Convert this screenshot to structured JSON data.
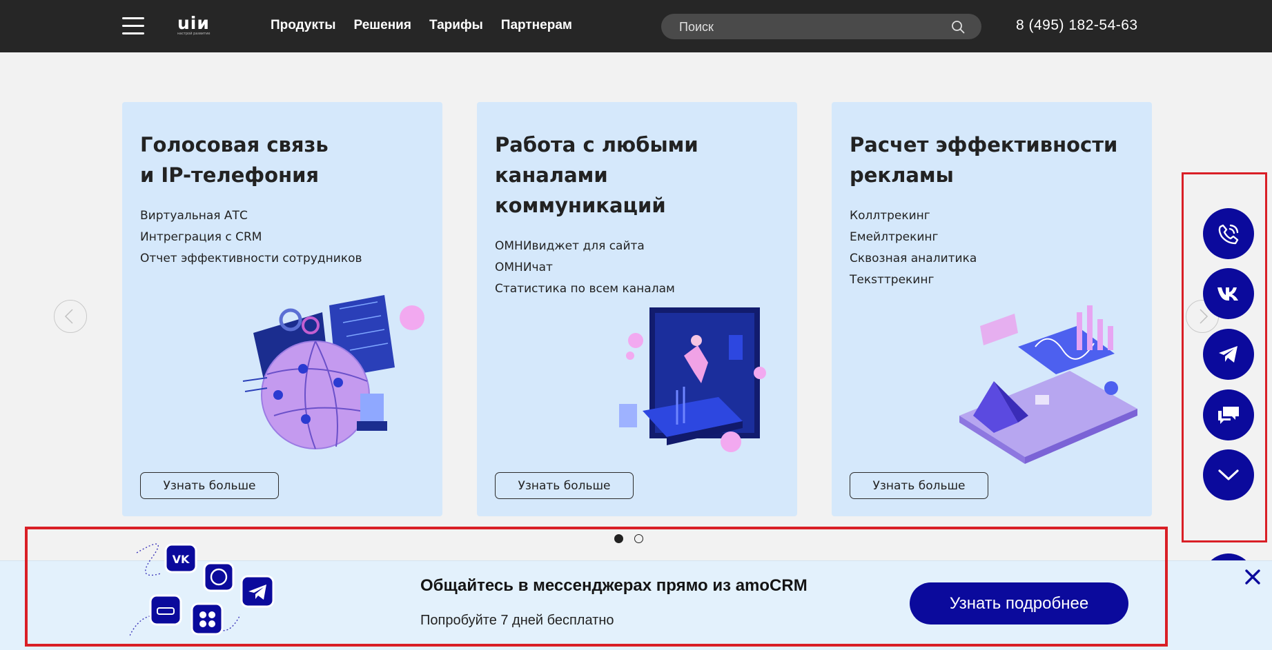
{
  "header": {
    "phone": "8 (495) 182-54-63",
    "logo_mark": "uiи",
    "logo_tagline": "настрой развитие",
    "nav": [
      "Продукты",
      "Решения",
      "Тарифы",
      "Партнерам"
    ],
    "search_placeholder": "Поиск"
  },
  "cards": [
    {
      "title_lines": [
        "Голосовая связь",
        "и IP-телефония"
      ],
      "items": [
        "Виртуальная АТС",
        "Интреграция с CRM",
        "Отчет эффективности сотрудников"
      ],
      "button": "Узнать больше"
    },
    {
      "title_lines": [
        "Работа с любыми",
        "каналами",
        "коммуникаций"
      ],
      "items": [
        "ОМНИвиджет для сайта",
        "ОМНИчат",
        "Статистика по всем каналам"
      ],
      "button": "Узнать больше"
    },
    {
      "title_lines": [
        "Расчет эффективности",
        "рекламы"
      ],
      "items": [
        "Коллтрекинг",
        "Емейлтрекинг",
        "Сквозная аналитика",
        "Текsттрекинг"
      ],
      "button": "Узнать больше"
    }
  ],
  "carousel": {
    "slide_count": 2,
    "active_index": 0
  },
  "side_widget": {
    "buttons": [
      "phone-call-icon",
      "vk-icon",
      "telegram-icon",
      "chat-icon",
      "chevron-down-icon"
    ],
    "accent": "#0b0a9c"
  },
  "banner": {
    "title": "Общайтесь в мессенджерах прямо из amoCRM",
    "subtitle": "Попробуйте 7 дней бесплатно",
    "button": "Узнать подробнее"
  },
  "colors": {
    "header_bg": "#262626",
    "card_bg": "#d5e8fb",
    "brand_blue": "#0b0a9c",
    "highlight_red": "#d91f26"
  }
}
